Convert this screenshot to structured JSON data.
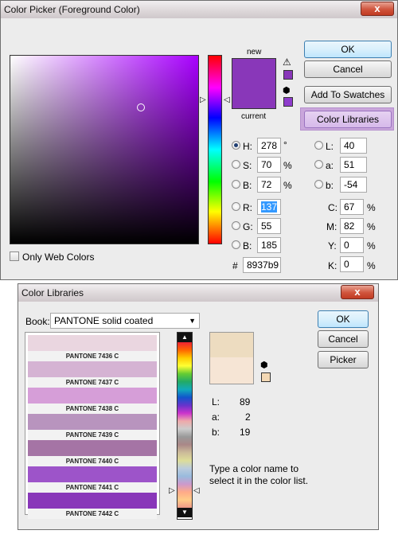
{
  "picker": {
    "title": "Color Picker (Foreground Color)",
    "close": "x",
    "new_label": "new",
    "current_label": "current",
    "new_color": "#8937b9",
    "current_color": "#8937b9",
    "buttons": {
      "ok": "OK",
      "cancel": "Cancel",
      "add_swatches": "Add To Swatches",
      "libraries": "Color Libraries"
    },
    "only_web": "Only Web Colors",
    "fields": {
      "H": {
        "label": "H:",
        "value": "278",
        "unit": "°"
      },
      "S": {
        "label": "S:",
        "value": "70",
        "unit": "%"
      },
      "B": {
        "label": "B:",
        "value": "72",
        "unit": "%"
      },
      "R": {
        "label": "R:",
        "value": "137"
      },
      "G": {
        "label": "G:",
        "value": "55"
      },
      "B2": {
        "label": "B:",
        "value": "185"
      },
      "L": {
        "label": "L:",
        "value": "40"
      },
      "a": {
        "label": "a:",
        "value": "51"
      },
      "b": {
        "label": "b:",
        "value": "-54"
      },
      "C": {
        "label": "C:",
        "value": "67",
        "unit": "%"
      },
      "M": {
        "label": "M:",
        "value": "82",
        "unit": "%"
      },
      "Y": {
        "label": "Y:",
        "value": "0",
        "unit": "%"
      },
      "K": {
        "label": "K:",
        "value": "0",
        "unit": "%"
      },
      "hex_label": "#",
      "hex": "8937b9"
    },
    "hue_color": "#a800ff"
  },
  "libraries": {
    "title": "Color Libraries",
    "close": "x",
    "book_label": "Book:",
    "book_value": "PANTONE solid coated",
    "buttons": {
      "ok": "OK",
      "cancel": "Cancel",
      "picker": "Picker"
    },
    "swatches": [
      {
        "name": "PANTONE 7436 C",
        "color": "#ead6e0"
      },
      {
        "name": "PANTONE 7437 C",
        "color": "#d5b3d3"
      },
      {
        "name": "PANTONE 7438 C",
        "color": "#d69ed8"
      },
      {
        "name": "PANTONE 7439 C",
        "color": "#b894be"
      },
      {
        "name": "PANTONE 7440 C",
        "color": "#a574a5"
      },
      {
        "name": "PANTONE 7441 C",
        "color": "#9d54c9"
      },
      {
        "name": "PANTONE 7442 C",
        "color": "#8937b9"
      }
    ],
    "preview_top": "#eddcc0",
    "preview_bottom": "#f6e5d5",
    "gamut_swatch": "#f3d8b4",
    "lab": {
      "L_label": "L:",
      "L": "89",
      "a_label": "a:",
      "a": "2",
      "b_label": "b:",
      "b": "19"
    },
    "hint": "Type a color name to select it in the color list."
  }
}
